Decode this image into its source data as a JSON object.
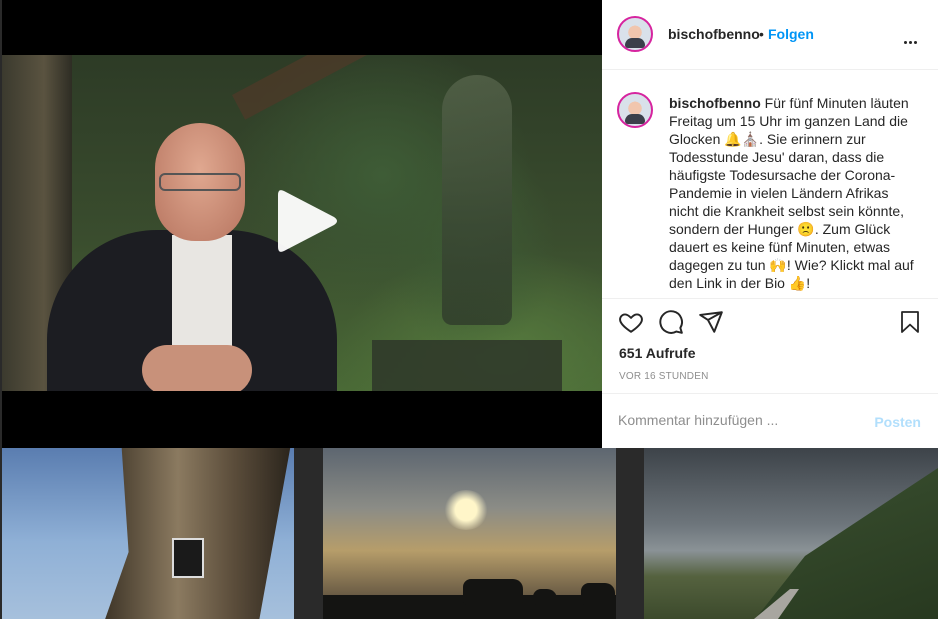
{
  "post": {
    "username": "bischofbenno",
    "separator": "•",
    "follow_label": "Folgen",
    "caption_username": "bischofbenno",
    "caption_text": "Für fünf Minuten läuten Freitag um 15 Uhr im ganzen Land die Glocken 🔔⛪. Sie erinnern zur Todesstunde Jesu' daran, dass die häufigste Todesursache der Corona-Pandemie in vielen Ländern Afrikas nicht die Krankheit selbst sein könnte, sondern der Hunger 🙁. Zum Glück dauert es keine fünf Minuten, etwas dagegen zu tun 🙌! Wie? Klickt mal auf den Link in der Bio 👍!",
    "views": "651 Aufrufe",
    "timestamp": "VOR 16 STUNDEN"
  },
  "comment": {
    "placeholder": "Kommentar hinzufügen ...",
    "post_label": "Posten"
  },
  "icons": {
    "like": "heart-icon",
    "comment": "comment-icon",
    "share": "send-icon",
    "save": "bookmark-icon",
    "more": "more-options-icon",
    "play": "play-icon"
  },
  "colors": {
    "link": "#0095f6",
    "post_disabled": "#b2dffc",
    "muted": "#8e8e8e",
    "text": "#262626"
  }
}
